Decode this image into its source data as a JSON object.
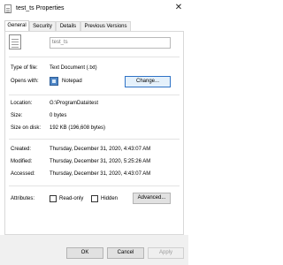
{
  "window": {
    "title": "test_ts Properties",
    "close_glyph": "✕"
  },
  "tabs": [
    {
      "label": "General",
      "active": true
    },
    {
      "label": "Security",
      "active": false
    },
    {
      "label": "Details",
      "active": false
    },
    {
      "label": "Previous Versions",
      "active": false
    }
  ],
  "file": {
    "name": "test_ts"
  },
  "type_of_file": {
    "label": "Type of file:",
    "value": "Text Document (.txt)"
  },
  "opens_with": {
    "label": "Opens with:",
    "app": "Notepad",
    "change_button": "Change..."
  },
  "location": {
    "label": "Location:",
    "value": "G:\\ProgramData\\test"
  },
  "size": {
    "label": "Size:",
    "value": "0 bytes"
  },
  "size_on_disk": {
    "label": "Size on disk:",
    "value": "192 KB (196,608 bytes)"
  },
  "created": {
    "label": "Created:",
    "value": "Thursday, December 31, 2020, 4:43:07 AM"
  },
  "modified": {
    "label": "Modified:",
    "value": "Thursday, December 31, 2020, 5:25:26 AM"
  },
  "accessed": {
    "label": "Accessed:",
    "value": "Thursday, December 31, 2020, 4:43:07 AM"
  },
  "attributes": {
    "label": "Attributes:",
    "read_only": {
      "label": "Read-only",
      "checked": false
    },
    "hidden": {
      "label": "Hidden",
      "checked": false
    },
    "advanced_button": "Advanced..."
  },
  "dialog_buttons": {
    "ok": "OK",
    "cancel": "Cancel",
    "apply": "Apply"
  }
}
